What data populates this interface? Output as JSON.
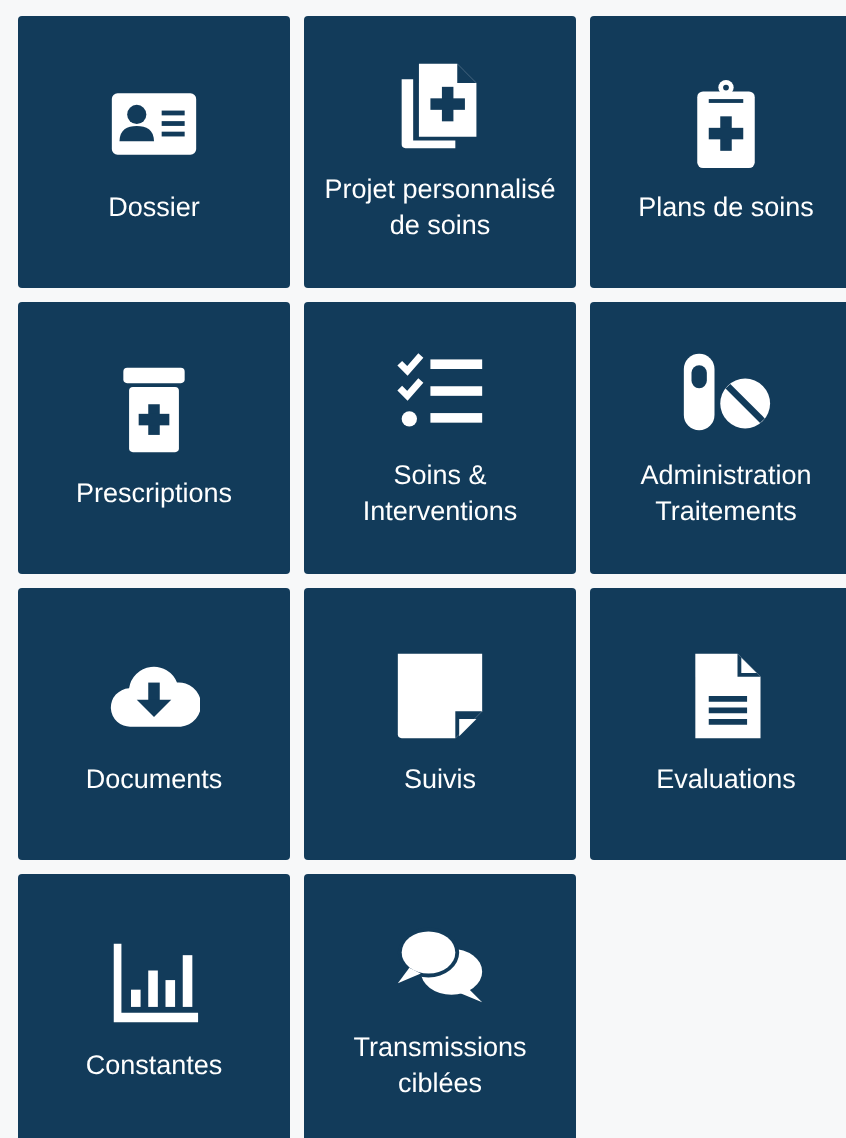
{
  "tiles": [
    {
      "kind": "id-card",
      "label": "Dossier"
    },
    {
      "kind": "documents-plus",
      "label": "Projet personnalisé de soins"
    },
    {
      "kind": "clipboard-plus",
      "label": "Plans de soins"
    },
    {
      "kind": "bottle-plus",
      "label": "Prescriptions"
    },
    {
      "kind": "checklist",
      "label": "Soins & Interventions"
    },
    {
      "kind": "pills",
      "label": "Administration Traitements"
    },
    {
      "kind": "cloud-download",
      "label": "Documents"
    },
    {
      "kind": "note",
      "label": "Suivis"
    },
    {
      "kind": "file-lines",
      "label": "Evaluations"
    },
    {
      "kind": "bar-chart",
      "label": "Constantes"
    },
    {
      "kind": "chat",
      "label": "Transmissions ciblées"
    }
  ]
}
